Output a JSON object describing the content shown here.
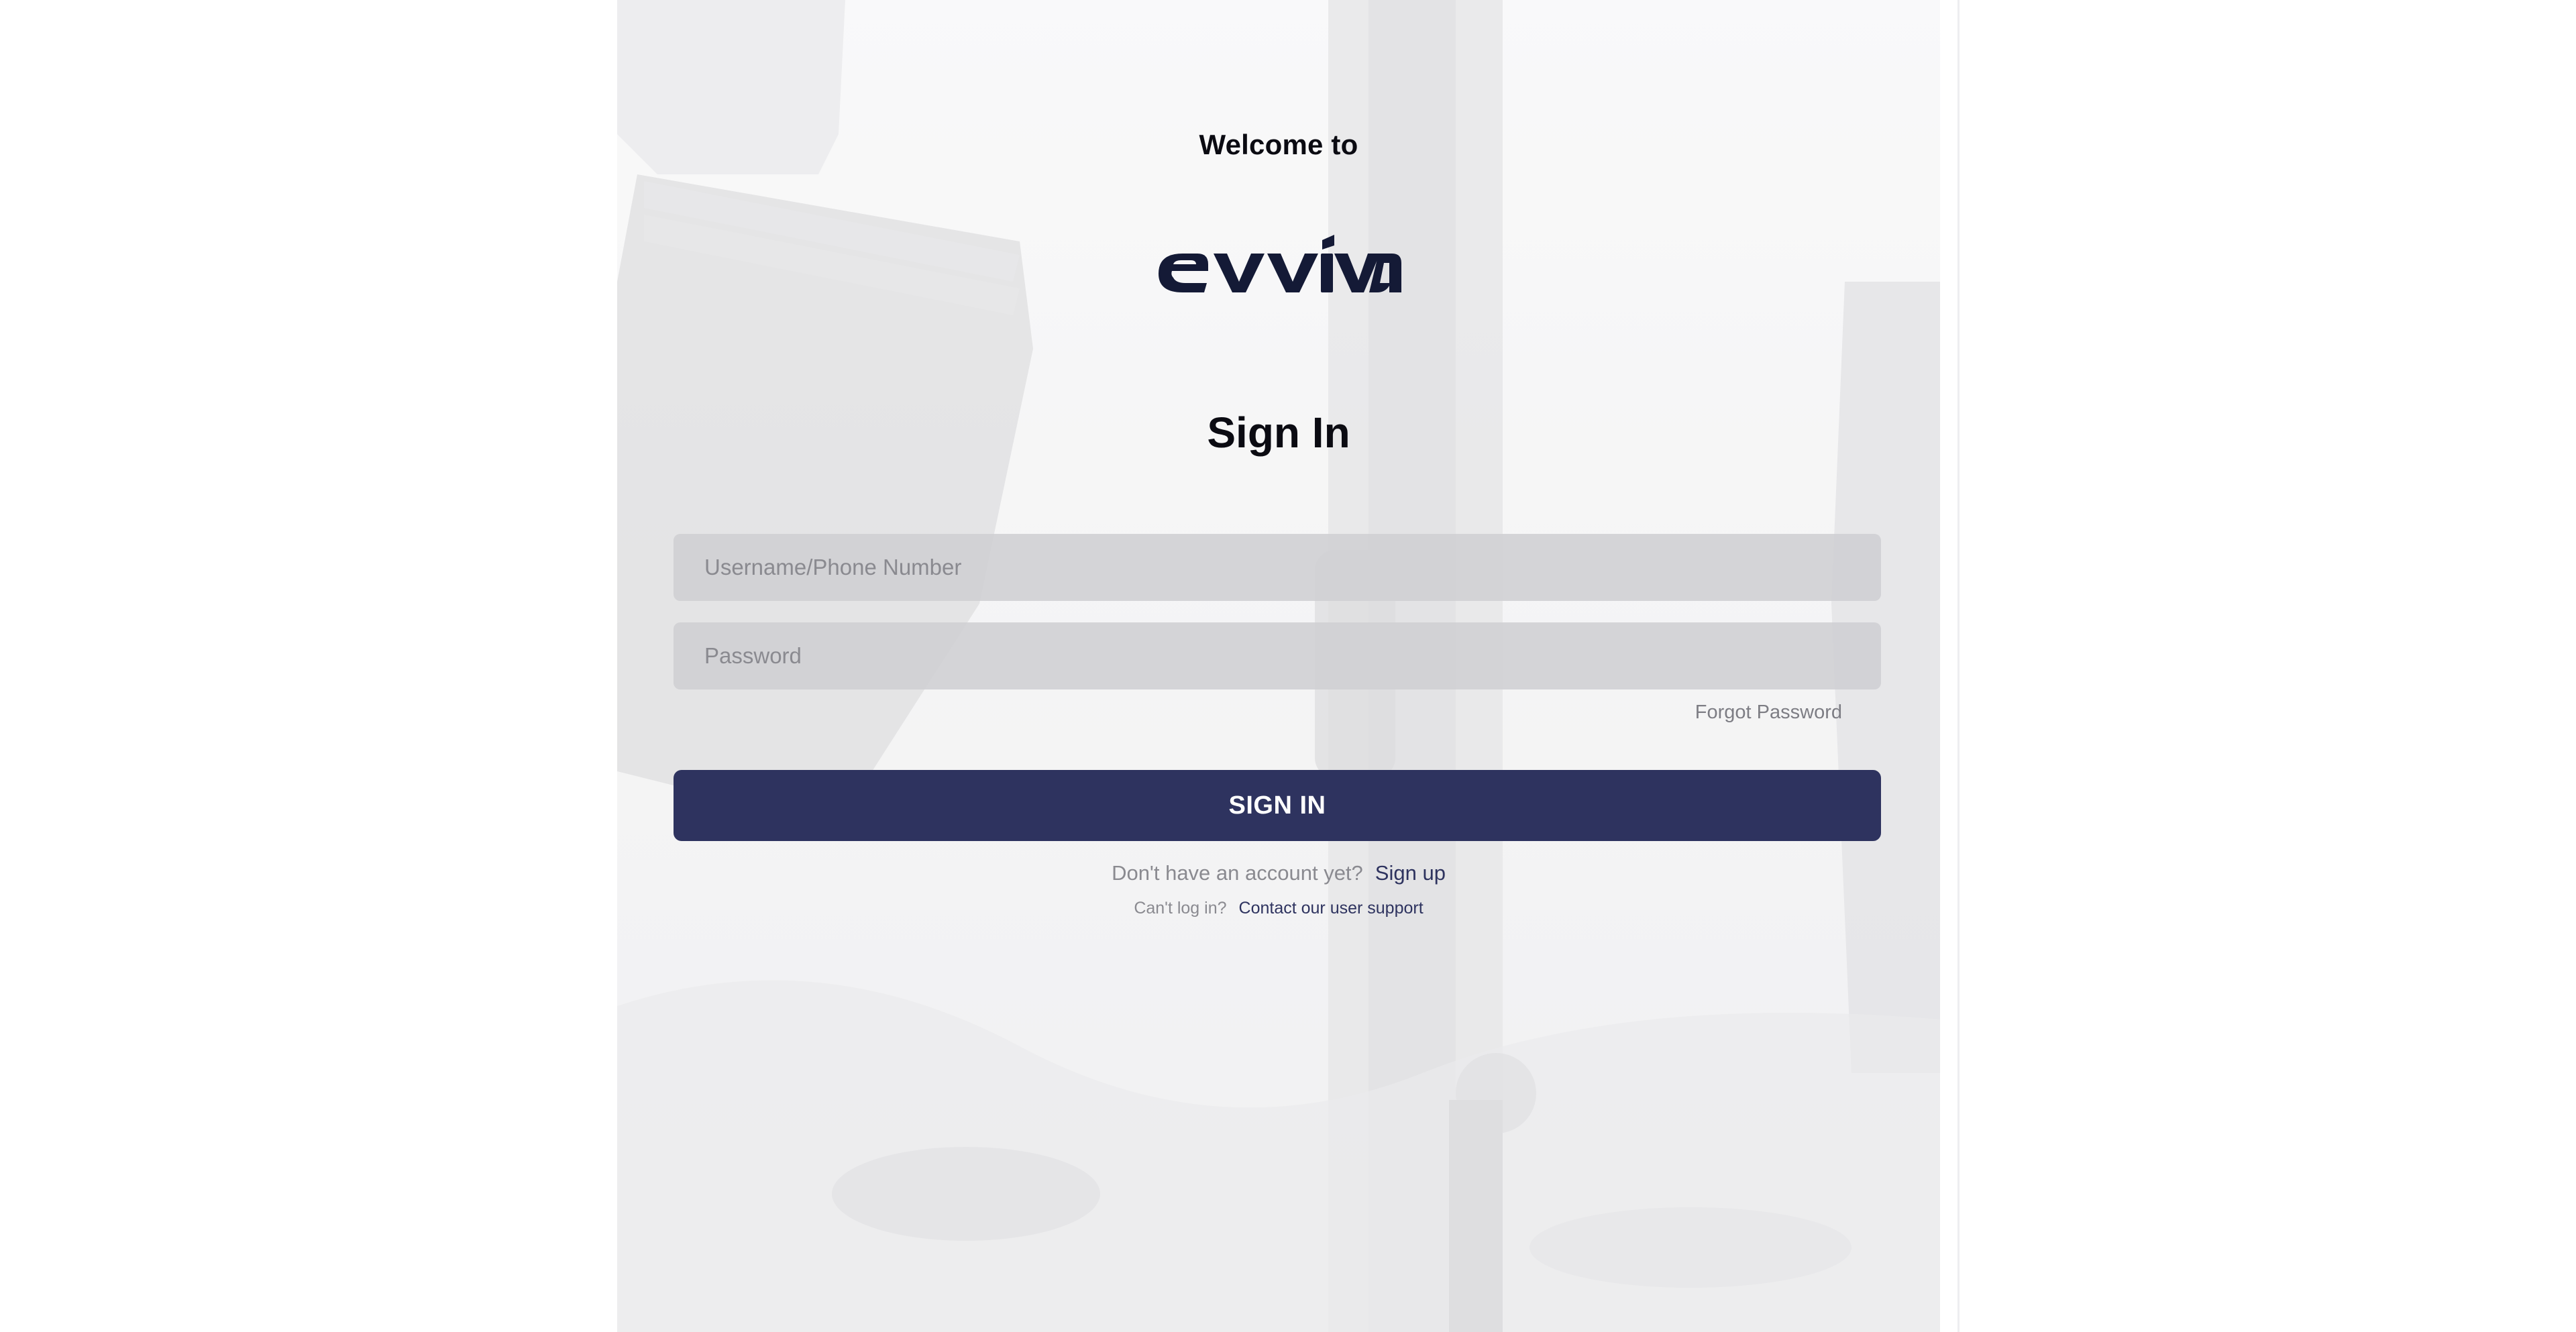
{
  "welcome_text": "Welcome to",
  "brand": {
    "name": "evviva",
    "color": "#141a36"
  },
  "form": {
    "title": "Sign In",
    "username_placeholder": "Username/Phone Number",
    "password_placeholder": "Password",
    "forgot_password": "Forgot Password",
    "submit_label": "SIGN IN"
  },
  "signup": {
    "prompt": "Don't have an account yet?",
    "link": "Sign up"
  },
  "support": {
    "prompt": "Can't log in?",
    "link": "Contact our user support"
  },
  "colors": {
    "primary": "#2e335f",
    "field_bg": "#d4d4d7",
    "muted_text": "#8a8a90"
  }
}
